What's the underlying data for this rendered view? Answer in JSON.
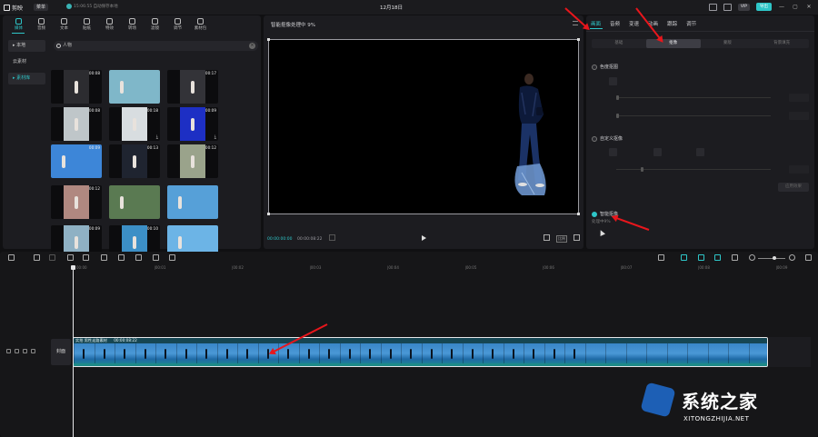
{
  "titlebar": {
    "app_name": "剪映",
    "menu_label": "菜单",
    "save_status": "15:06:55 自动保存本地",
    "doc_title": "12月18日",
    "vip_label": "VIP",
    "export_label": "导出",
    "window_controls": [
      "—",
      "▢",
      "✕"
    ]
  },
  "media_tabs": [
    {
      "label": "媒体",
      "icon": "media-icon"
    },
    {
      "label": "音频",
      "icon": "audio-icon"
    },
    {
      "label": "文本",
      "icon": "text-icon"
    },
    {
      "label": "贴纸",
      "icon": "sticker-icon"
    },
    {
      "label": "特效",
      "icon": "effects-icon"
    },
    {
      "label": "转场",
      "icon": "transition-icon"
    },
    {
      "label": "滤镜",
      "icon": "filter-icon"
    },
    {
      "label": "调节",
      "icon": "adjust-icon"
    },
    {
      "label": "素材包",
      "icon": "package-icon"
    }
  ],
  "side_categories": [
    {
      "label": "▸ 本地"
    },
    {
      "label": "云素材"
    },
    {
      "label": "▸ 素材库"
    }
  ],
  "search": {
    "value": "人物"
  },
  "thumbnails": [
    {
      "duration": "00:08",
      "color": "#2c2c30",
      "wide": false
    },
    {
      "duration": "",
      "color": "#7fb7c9",
      "wide": true
    },
    {
      "duration": "00:17",
      "color": "#333338",
      "wide": false
    },
    {
      "duration": "00:08",
      "color": "#bfc6c9",
      "wide": false
    },
    {
      "duration": "00:18",
      "color": "#d8dde0",
      "wide": false
    },
    {
      "duration": "00:09",
      "color": "#1d2fc4",
      "wide": false
    },
    {
      "duration": "00:09",
      "color": "#3d86d8",
      "wide": true
    },
    {
      "duration": "00:13",
      "color": "#1f2430",
      "wide": false
    },
    {
      "duration": "00:12",
      "color": "#9aa38b",
      "wide": false
    },
    {
      "duration": "00:12",
      "color": "#b08880",
      "wide": false
    },
    {
      "duration": "",
      "color": "#5a7a52",
      "wide": true
    },
    {
      "duration": "",
      "color": "#56a0d8",
      "wide": true
    },
    {
      "duration": "00:09",
      "color": "#8fb1c4",
      "wide": false
    },
    {
      "duration": "00:10",
      "color": "#3c8fc6",
      "wide": false
    },
    {
      "duration": "",
      "color": "#6cb4e6",
      "wide": true
    }
  ],
  "player": {
    "title": "智能抠像处理中 9%",
    "current_time": "00:00:00:00",
    "total_time": "00:00:08:22",
    "ratio_label": "比例"
  },
  "right_panel": {
    "tabs": [
      "画面",
      "音频",
      "变速",
      "动画",
      "跟踪",
      "调节"
    ],
    "active_tab": "画面",
    "sub_tabs": [
      "基础",
      "抠像",
      "蒙版",
      "背景填充"
    ],
    "active_sub_tab": "抠像",
    "chroma_key_label": "色度抠图",
    "custom_cutout_label": "自定义抠像",
    "smart_cutout_label": "智能抠像",
    "smart_cutout_status": "处理中9%",
    "apply_button": "应用效果",
    "smart_cutout_checked": true
  },
  "timeline": {
    "ruler_labels": [
      "00:00",
      "|00:01",
      "|00:02",
      "|00:03",
      "|00:04",
      "|00:05",
      "|00:06",
      "|00:07",
      "|00:08",
      "|00:09"
    ],
    "cover_label": "封面",
    "clip_title": "实拍 男性走路素材",
    "clip_duration": "00:00:08:22"
  },
  "watermark": {
    "title": "系统之家",
    "url": "XITONGZHIJIA.NET"
  },
  "colors": {
    "accent": "#2ec6c8",
    "annotation_arrow": "#e8161c"
  }
}
